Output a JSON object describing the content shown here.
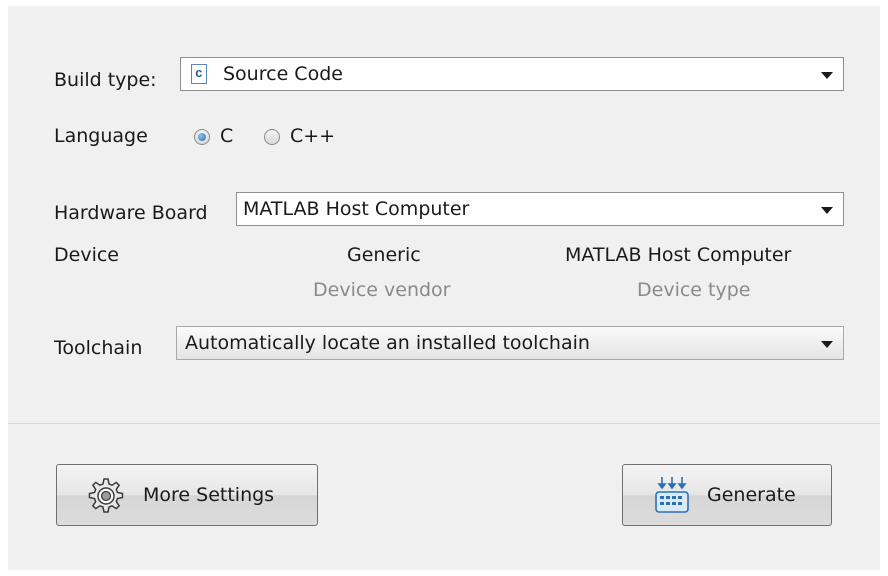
{
  "build": {
    "label": "Build type:",
    "value": "Source Code",
    "icon": "c-source-file-icon"
  },
  "language": {
    "label": "Language",
    "options": [
      {
        "label": "C",
        "selected": true
      },
      {
        "label": "C++",
        "selected": false
      }
    ]
  },
  "hardware": {
    "label": "Hardware Board",
    "value": "MATLAB Host Computer"
  },
  "device": {
    "label": "Device",
    "vendor_value": "Generic",
    "vendor_caption": "Device vendor",
    "type_value": "MATLAB Host Computer",
    "type_caption": "Device type"
  },
  "toolchain": {
    "label": "Toolchain",
    "value": "Automatically locate an installed toolchain"
  },
  "buttons": {
    "more_settings": "More Settings",
    "generate": "Generate"
  },
  "colors": {
    "accent": "#2b6fb3",
    "caption": "#8a8a8a"
  }
}
